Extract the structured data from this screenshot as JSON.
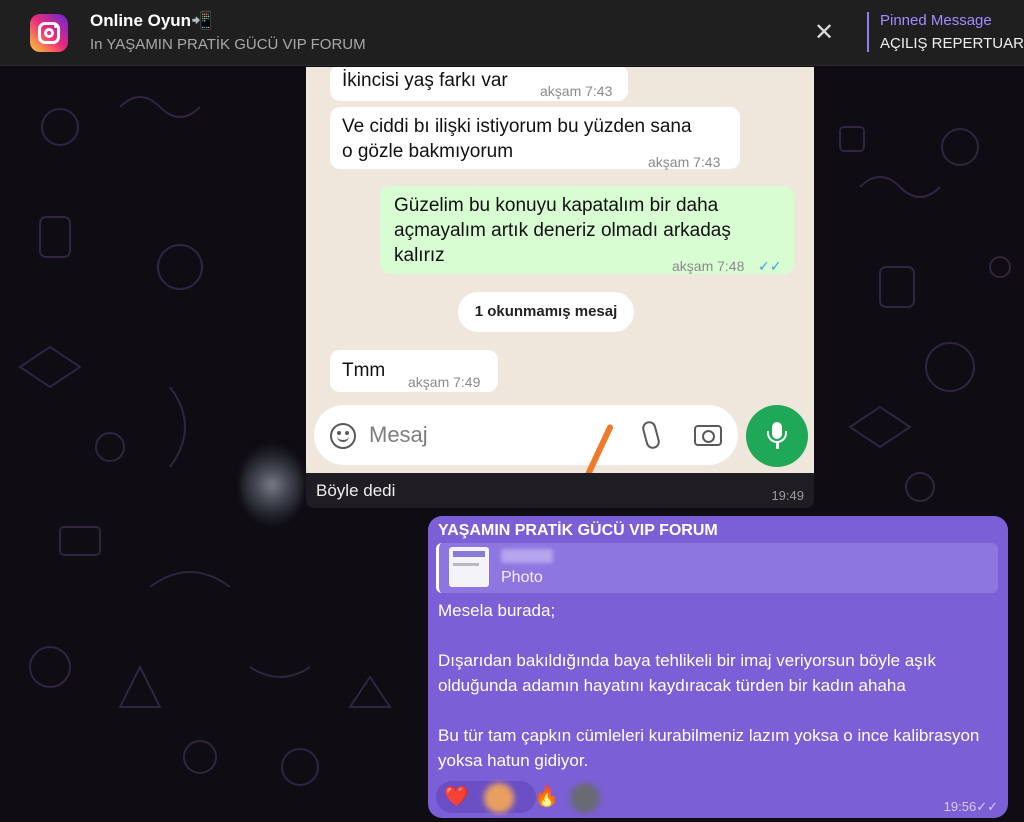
{
  "header": {
    "app_icon": "instagram-icon",
    "title": "Online Oyun📲",
    "subtitle": "In YAŞAMIN PRATİK GÜCÜ VIP FORUM",
    "close_icon": "close-icon",
    "pinned_label": "Pinned Message",
    "pinned_text": "AÇILIŞ REPERTUAR"
  },
  "photo_message": {
    "whatsapp": {
      "messages": [
        {
          "text": "İkincisi yaş farkı var",
          "time": "akşam 7:43",
          "direction": "in"
        },
        {
          "text": "Ve ciddi bı ilişki istiyorum bu yüzden sana\no gözle bakmıyorum",
          "time": "akşam 7:43",
          "direction": "in"
        },
        {
          "text": "Güzelim bu konuyu kapatalım bir daha\naçmayalım artık deneriz olmadı arkadaş\nkalırız",
          "time": "akşam 7:48",
          "direction": "out",
          "ticks": "✓✓"
        },
        {
          "text": "Tmm",
          "time": "akşam 7:49",
          "direction": "in"
        }
      ],
      "unread_label": "1 okunmamış mesaj",
      "input_placeholder": "Mesaj"
    },
    "caption": "Böyle dedi",
    "time": "19:49"
  },
  "outgoing_message": {
    "forwarded_from": "YAŞAMIN PRATİK GÜCÜ VIP FORUM",
    "reply_type": "Photo",
    "text": "Mesela burada;\n\nDışarıdan bakıldığında baya tehlikeli bir imaj veriyorsun böyle aşık olduğunda adamın hayatını kaydıracak türden bir kadın ahaha\n\nBu tür tam çapkın cümleleri kurabilmeniz lazım yoksa o ince kalibrasyon yoksa hatun gidiyor.",
    "reactions": [
      {
        "emoji": "❤️"
      },
      {
        "emoji": "🔥"
      }
    ],
    "time": "19:56",
    "ticks": "✓✓"
  },
  "colors": {
    "accent": "#7b5fd6",
    "whatsapp_green": "#1fa855",
    "pinned": "#a38cff"
  }
}
